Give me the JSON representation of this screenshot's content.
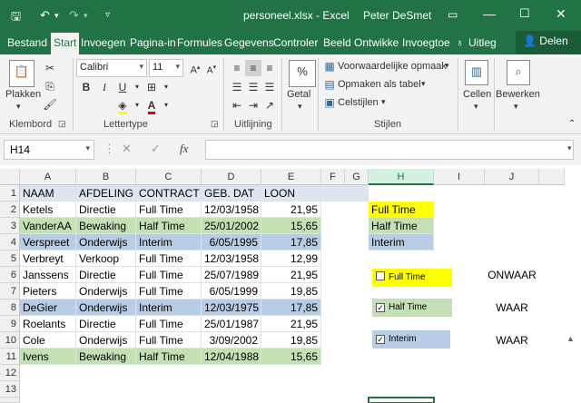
{
  "titlebar": {
    "title": "personeel.xlsx - Excel",
    "user": "Peter DeSmet",
    "save_icon": "save-icon",
    "undo_icon": "undo-icon",
    "redo_icon": "redo-icon"
  },
  "tabs": [
    "Bestand",
    "Start",
    "Invoegen",
    "Pagina-in",
    "Formules",
    "Gegevens",
    "Controler",
    "Beeld",
    "Ontwikke",
    "Invoegtoe"
  ],
  "tell_me": "Uitleg",
  "share": "Delen",
  "ribbon": {
    "paste_label": "Plakken",
    "clipboard_label": "Klembord",
    "font_name": "Calibri",
    "font_size": "11",
    "font_group_label": "Lettertype",
    "align_group_label": "Uitlijning",
    "number_label": "Getal",
    "cond_format": "Voorwaardelijke opmaak",
    "format_table": "Opmaken als tabel",
    "cell_styles": "Celstijlen",
    "styles_group_label": "Stijlen",
    "cells_label": "Cellen",
    "edit_label": "Bewerken"
  },
  "formula_bar": {
    "name_box": "H14",
    "fx": "fx",
    "cancel": "✕",
    "confirm": "✓",
    "formula": ""
  },
  "columns": [
    "A",
    "B",
    "C",
    "D",
    "E",
    "F",
    "G",
    "H",
    "I",
    "J"
  ],
  "rows": [
    "1",
    "2",
    "3",
    "4",
    "5",
    "6",
    "7",
    "8",
    "9",
    "10",
    "11",
    "12",
    "13",
    "14"
  ],
  "table": {
    "headers": [
      "NAAM",
      "AFDELING",
      "CONTRACT",
      "GEB. DAT",
      "LOON"
    ],
    "records": [
      [
        "Ketels",
        "Directie",
        "Full Time",
        "12/03/1958",
        "21,95"
      ],
      [
        "VanderAA",
        "Bewaking",
        "Half Time",
        "25/01/2002",
        "15,65"
      ],
      [
        "Verspreet",
        "Onderwijs",
        "Interim",
        "6/05/1995",
        "17,85"
      ],
      [
        "Verbreyt",
        "Verkoop",
        "Full Time",
        "12/03/1958",
        "12,99"
      ],
      [
        "Janssens",
        "Directie",
        "Full Time",
        "25/07/1989",
        "21,95"
      ],
      [
        "Pieters",
        "Onderwijs",
        "Full Time",
        "6/05/1999",
        "19,85"
      ],
      [
        "DeGier",
        "Onderwijs",
        "Interim",
        "12/03/1975",
        "17,85"
      ],
      [
        "Roelants",
        "Directie",
        "Full Time",
        "25/01/1987",
        "21,95"
      ],
      [
        "Cole",
        "Onderwijs",
        "Full Time",
        "3/09/2002",
        "19,85"
      ],
      [
        "Ivens",
        "Bewaking",
        "Half Time",
        "12/04/1988",
        "15,65"
      ]
    ]
  },
  "legend": [
    "Full Time",
    "Half Time",
    "Interim"
  ],
  "checkboxes": [
    {
      "label": "Full Time",
      "checked": false,
      "result": "ONWAAR"
    },
    {
      "label": "Half Time",
      "checked": true,
      "result": "WAAR"
    },
    {
      "label": "Interim",
      "checked": true,
      "result": "WAAR"
    }
  ],
  "colors": {
    "excel_green": "#217346",
    "blue_fill": "#b8cce4",
    "green_fill": "#c4dfb4",
    "yellow_fill": "#ffff00",
    "header_fill": "#dce6f1"
  }
}
